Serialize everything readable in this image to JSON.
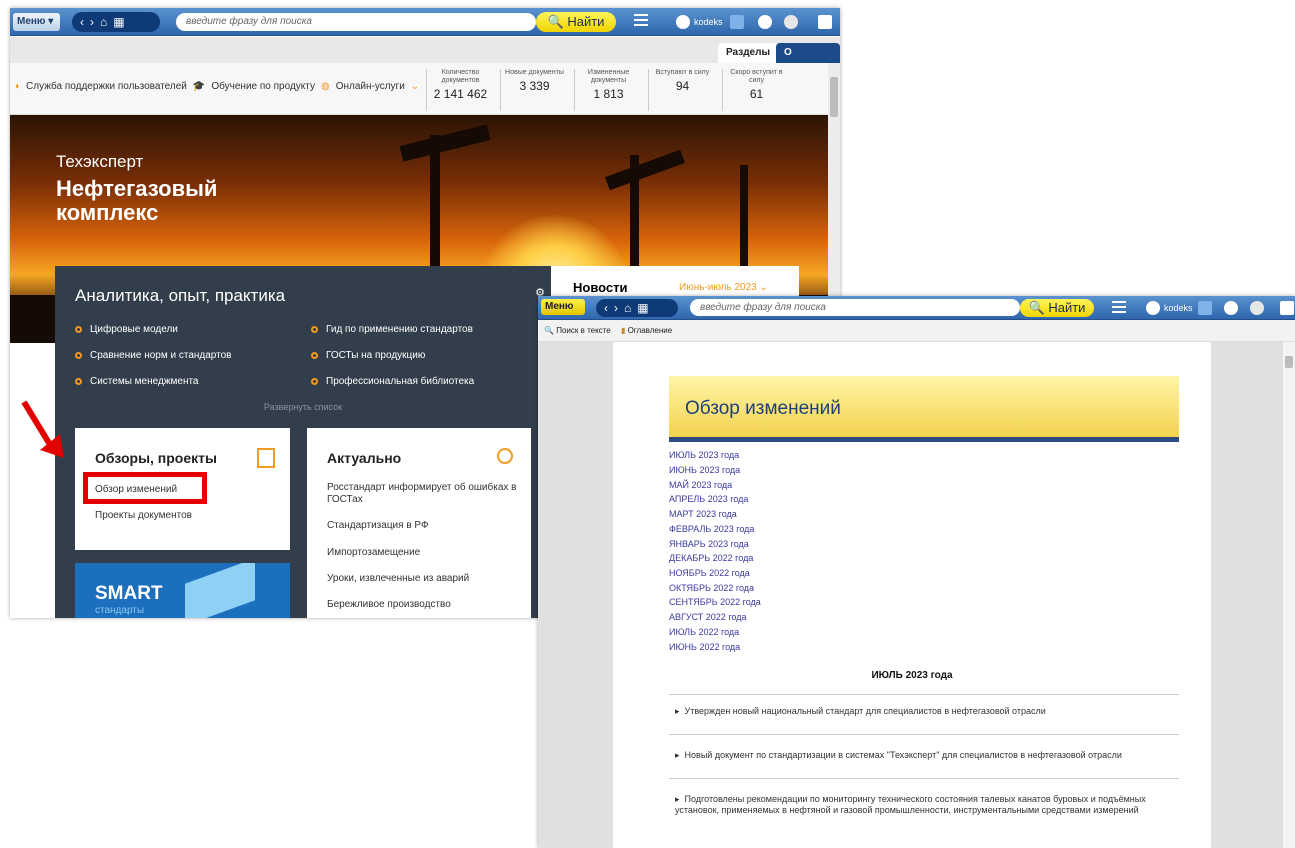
{
  "w1": {
    "menu": "Меню",
    "search_placeholder": "введите фразу для поиска",
    "find": "Найти",
    "user": "kodeks",
    "tabs": [
      "Разделы",
      "О системе"
    ],
    "links": [
      "Служба поддержки пользователей",
      "Обучение по продукту",
      "Онлайн-услуги"
    ],
    "stats": [
      {
        "label": "Количество документов",
        "value": "2 141 462"
      },
      {
        "label": "Новые документы",
        "value": "3 339"
      },
      {
        "label": "Измененные документы",
        "value": "1 813"
      },
      {
        "label": "Вступают в силу",
        "value": "94"
      },
      {
        "label": "Скоро вступит в силу",
        "value": "61"
      }
    ],
    "hero_sub": "Техэксперт",
    "hero_title": "Нефтегазовый комплекс",
    "panel_title": "Аналитика, опыт, практика",
    "panel_items": [
      "Цифровые модели",
      "Гид по применению стандартов",
      "Сравнение норм и стандартов",
      "ГОСТы на продукцию",
      "Системы менеджмента",
      "Профессиональная библиотека"
    ],
    "expand": "Развернуть список",
    "card1_title": "Обзоры, проекты",
    "card1_items": [
      "Обзор изменений",
      "Проекты документов"
    ],
    "card2_title": "Актуально",
    "card2_items": [
      "Росстандарт информирует об ошибках в ГОСТах",
      "Стандартизация в РФ",
      "Импортозамещение",
      "Уроки, извлеченные из аварий",
      "Бережливое производство"
    ],
    "smart": "SMART",
    "smart_sub": "стандарты",
    "news_title": "Новости",
    "news_date": "Июнь-июль 2023"
  },
  "w2": {
    "menu": "Меню",
    "search_placeholder": "введите фразу для поиска",
    "find": "Найти",
    "user": "kodeks",
    "tool1": "Поиск в тексте",
    "tool2": "Оглавление",
    "banner": "Обзор изменений",
    "months": [
      "ИЮЛЬ 2023 года",
      "ИЮНЬ 2023 года",
      "МАЙ 2023 года",
      "АПРЕЛЬ 2023 года",
      "МАРТ 2023 года",
      "ФЕВРАЛЬ 2023 года",
      "ЯНВАРЬ 2023 года",
      "ДЕКАБРЬ 2022 года",
      "НОЯБРЬ 2022 года",
      "ОКТЯБРЬ 2022 года",
      "СЕНТЯБРЬ 2022 года",
      "АВГУСТ 2022 года",
      "ИЮЛЬ 2022 года",
      "ИЮНЬ 2022 года"
    ],
    "section": "ИЮЛЬ 2023 года",
    "news": [
      "Утвержден новый национальный стандарт для специалистов в нефтегазовой отрасли",
      "Новый документ по стандартизации в системах \"Техэксперт\" для специалистов в нефтегазовой отрасли",
      "Подготовлены рекомендации по мониторингу технического состояния талевых канатов буровых и подъёмных установок, применяемых в нефтяной и газовой промышленности, инструментальными средствами измерений"
    ]
  }
}
